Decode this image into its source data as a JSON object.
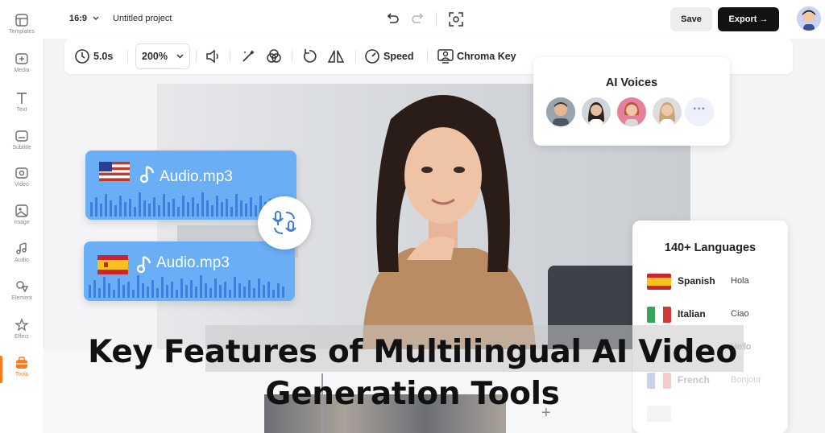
{
  "sidebar": {
    "items": [
      {
        "label": "Templates",
        "icon": "templates-icon"
      },
      {
        "label": "Media",
        "icon": "media-icon"
      },
      {
        "label": "Text",
        "icon": "text-icon"
      },
      {
        "label": "Subtitle",
        "icon": "subtitle-icon"
      },
      {
        "label": "Video",
        "icon": "video-icon"
      },
      {
        "label": "Image",
        "icon": "image-icon"
      },
      {
        "label": "Audio",
        "icon": "audio-icon"
      },
      {
        "label": "Element",
        "icon": "element-icon"
      },
      {
        "label": "Effect",
        "icon": "effect-icon"
      },
      {
        "label": "Tools",
        "icon": "tools-icon"
      }
    ],
    "active": "Tools"
  },
  "topbar": {
    "aspect_ratio": "16:9",
    "project_name": "Untitled project",
    "save_label": "Save",
    "export_label": "Export"
  },
  "toolbar": {
    "duration": "5.0s",
    "zoom": "200%",
    "speed_label": "Speed",
    "chroma_label": "Chroma Key"
  },
  "audio_cards": [
    {
      "flag": "us",
      "filename": "Audio.mp3"
    },
    {
      "flag": "es",
      "filename": "Audio.mp3"
    }
  ],
  "voices_panel": {
    "title": "AI Voices",
    "more": "···"
  },
  "languages_panel": {
    "title": "140+ Languages",
    "rows": [
      {
        "flag": "es",
        "language": "Spanish",
        "greeting": "Hola"
      },
      {
        "flag": "it",
        "language": "Italian",
        "greeting": "Ciao"
      },
      {
        "flag": "",
        "language": "",
        "greeting": "Hello"
      },
      {
        "flag": "fr",
        "language": "French",
        "greeting": "Bonjour"
      }
    ]
  },
  "headline": {
    "line1": "Key Features of Multilingual AI Video",
    "line2": "Generation Tools"
  },
  "colors": {
    "accent": "#ff7a1a",
    "audio_card": "#6aaef6",
    "export_button": "#121212"
  }
}
